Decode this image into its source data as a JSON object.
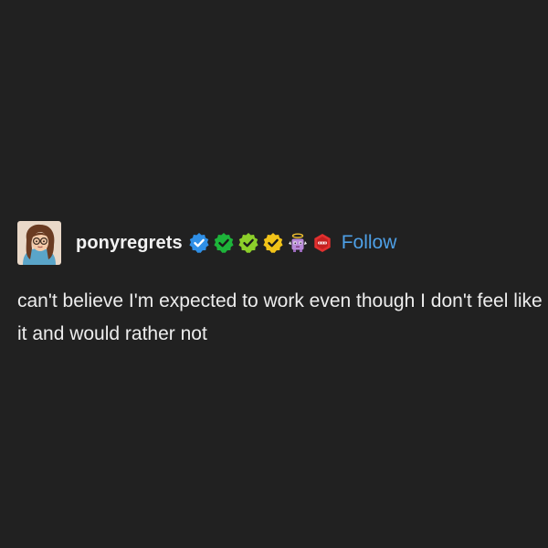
{
  "post": {
    "username": "ponyregrets",
    "follow_label": "Follow",
    "text": "can't believe I'm expected to work even though I don't feel like it and would rather not",
    "badges": [
      {
        "name": "blue-verified-badge-icon",
        "color": "#2f8fe6"
      },
      {
        "name": "green-verified-badge-icon",
        "color": "#1db43a"
      },
      {
        "name": "lime-verified-badge-icon",
        "color": "#8ccf2a"
      },
      {
        "name": "yellow-verified-badge-icon",
        "color": "#f2c318"
      },
      {
        "name": "angel-sprite-badge-icon",
        "color": "#b788d8"
      },
      {
        "name": "red-counter-badge-icon",
        "color": "#e2302f"
      }
    ]
  }
}
